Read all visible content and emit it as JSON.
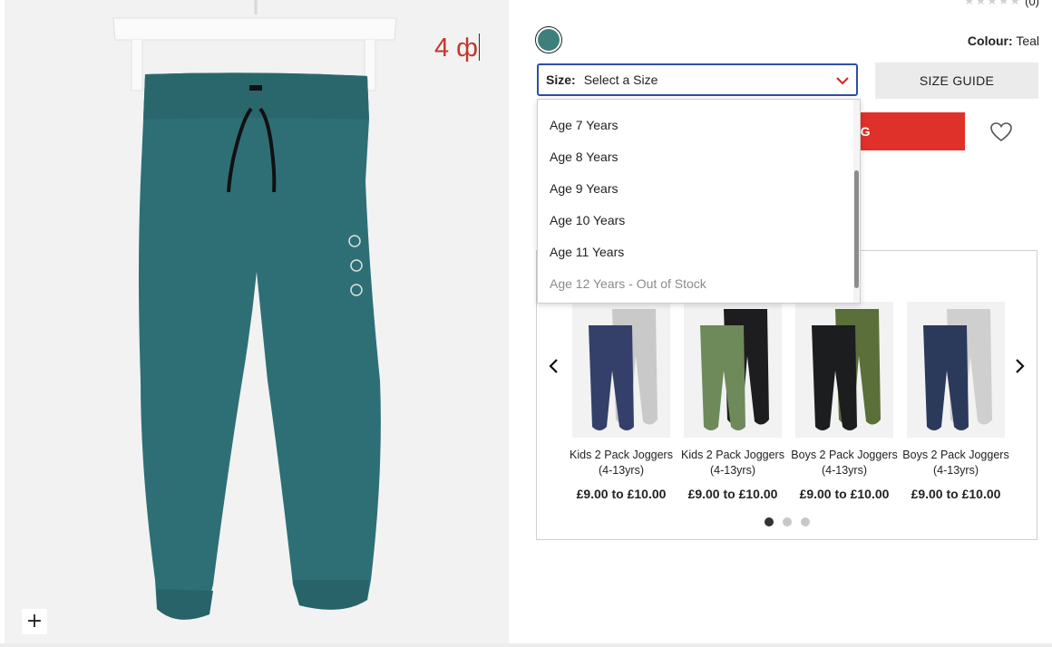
{
  "overlay": {
    "typed_text": "4 ф"
  },
  "rating": {
    "stars": "★★★★★",
    "count": "(0)"
  },
  "colour": {
    "label": "Colour:",
    "value": "Teal",
    "swatch_color": "#3d7f7d"
  },
  "size": {
    "label": "Size:",
    "selected": "Select a Size",
    "options": [
      {
        "label": "Age 7 Years",
        "available": true
      },
      {
        "label": "Age 8 Years",
        "available": true
      },
      {
        "label": "Age 9 Years",
        "available": true
      },
      {
        "label": "Age 10 Years",
        "available": true
      },
      {
        "label": "Age 11 Years",
        "available": true
      },
      {
        "label": "Age 12 Years - Out of Stock",
        "available": false
      }
    ]
  },
  "buttons": {
    "size_guide": "SIZE GUIDE",
    "add_to_bag": "AG"
  },
  "accent": {
    "add_to_bag_color": "#e0302a",
    "focus_border": "#2e4fa8"
  },
  "recommendations": [
    {
      "name": "Kids 2 Pack Joggers (4-13yrs)",
      "price": "£9.00 to £10.00",
      "colors": [
        "#34406a",
        "#c9c9c9"
      ]
    },
    {
      "name": "Kids 2 Pack Joggers (4-13yrs)",
      "price": "£9.00 to £10.00",
      "colors": [
        "#6f8a5a",
        "#1d1d1f"
      ]
    },
    {
      "name": "Boys 2 Pack Joggers (4-13yrs)",
      "price": "£9.00 to £10.00",
      "colors": [
        "#1b1d1e",
        "#5b6f3a"
      ]
    },
    {
      "name": "Boys 2 Pack Joggers (4-13yrs)",
      "price": "£9.00 to £10.00",
      "colors": [
        "#2b3a5a",
        "#cfcfcf"
      ]
    }
  ],
  "carousel": {
    "pages": 3,
    "active_page": 1
  },
  "zoom_icon": "plus-icon"
}
